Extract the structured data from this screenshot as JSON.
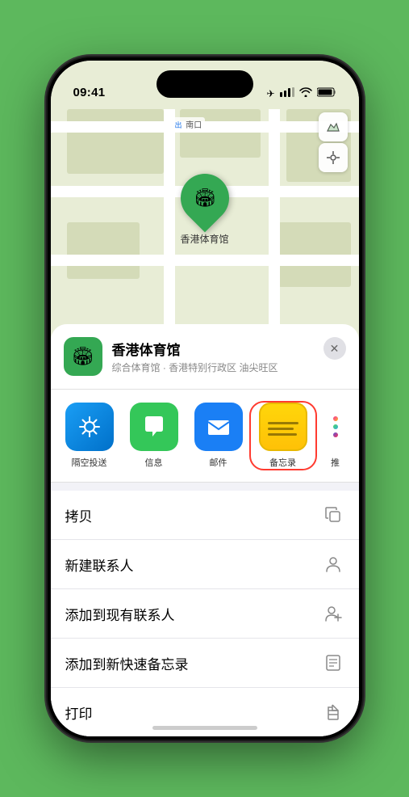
{
  "status_bar": {
    "time": "09:41",
    "location_arrow": "▶",
    "signal": "▐▐▐",
    "wifi": "WiFi",
    "battery": "🔋"
  },
  "map": {
    "label_text": "南口",
    "map_type_icon": "🗺",
    "location_icon": "⊕"
  },
  "location_pin": {
    "label": "香港体育馆",
    "icon": "🏟"
  },
  "venue_sheet": {
    "icon": "🏟",
    "name": "香港体育馆",
    "subtitle": "综合体育馆 · 香港特别行政区 油尖旺区",
    "close_icon": "✕"
  },
  "share_items": [
    {
      "id": "airdrop",
      "label": "隔空投送",
      "type": "airdrop"
    },
    {
      "id": "messages",
      "label": "信息",
      "type": "messages"
    },
    {
      "id": "mail",
      "label": "邮件",
      "type": "mail"
    },
    {
      "id": "notes",
      "label": "备忘录",
      "type": "notes",
      "highlighted": true
    },
    {
      "id": "more",
      "label": "推",
      "type": "more"
    }
  ],
  "actions": [
    {
      "id": "copy",
      "label": "拷贝",
      "icon": "copy"
    },
    {
      "id": "new-contact",
      "label": "新建联系人",
      "icon": "person"
    },
    {
      "id": "add-existing",
      "label": "添加到现有联系人",
      "icon": "person-add"
    },
    {
      "id": "add-note",
      "label": "添加到新快速备忘录",
      "icon": "note"
    },
    {
      "id": "print",
      "label": "打印",
      "icon": "print"
    }
  ]
}
